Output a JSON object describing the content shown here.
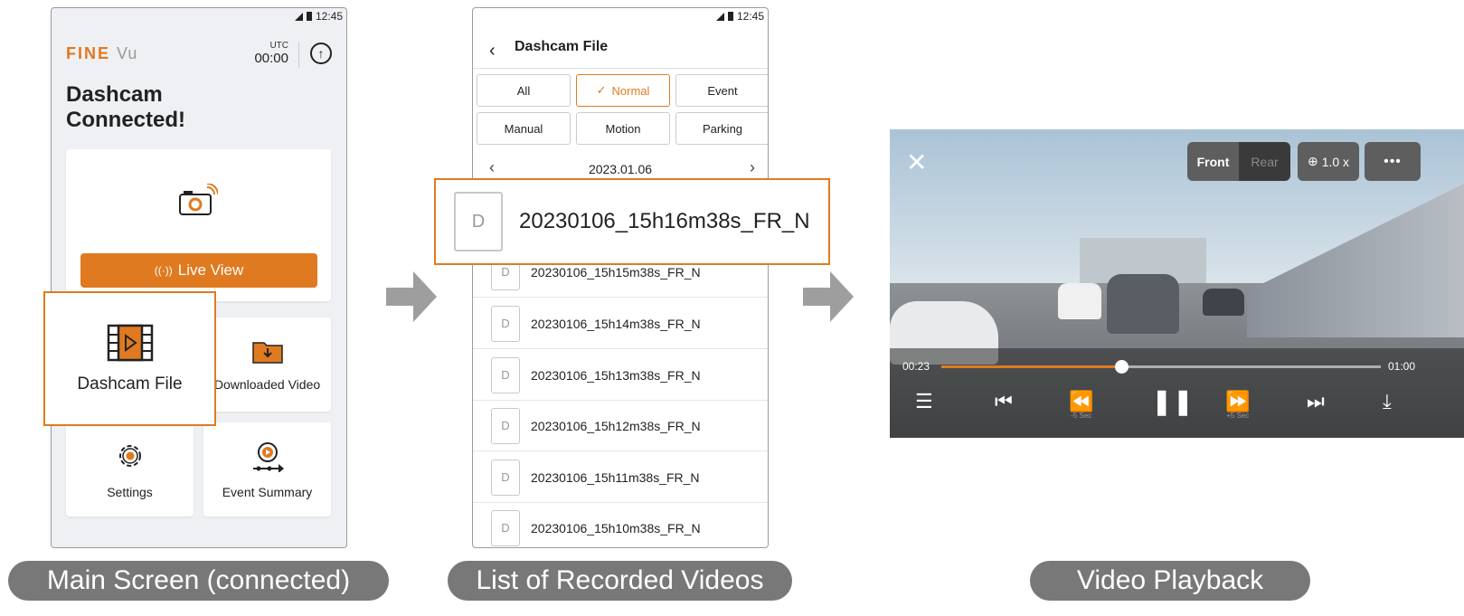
{
  "main_screen": {
    "status_time": "12:45",
    "logo_fine": "FINE",
    "logo_vu": "Vu",
    "utc_label": "UTC",
    "utc_time": "00:00",
    "headline": "Dashcam Connected!",
    "live_view_label": "Live View",
    "dashcam_file_label": "Dashcam File",
    "downloaded_video_label": "Downloaded Video",
    "settings_label": "Settings",
    "event_summary_label": "Event Summary",
    "accent_color": "#e07a20"
  },
  "file_list": {
    "status_time": "12:45",
    "title": "Dashcam File",
    "filters": [
      "All",
      "Normal",
      "Event",
      "Manual",
      "Motion",
      "Parking"
    ],
    "active_filter": "Normal",
    "date": "2023.01.06",
    "highlighted_file": "20230106_15h16m38s_FR_N",
    "file_icon_letter": "D",
    "files": [
      "20230106_15h15m38s_FR_N",
      "20230106_15h14m38s_FR_N",
      "20230106_15h13m38s_FR_N",
      "20230106_15h12m38s_FR_N",
      "20230106_15h11m38s_FR_N",
      "20230106_15h10m38s_FR_N"
    ]
  },
  "player": {
    "front_label": "Front",
    "rear_label": "Rear",
    "zoom_label": "1.0 x",
    "current_time": "00:23",
    "end_time": "01:00",
    "progress_fraction": 0.41,
    "rewind_label": "-5 Sec",
    "forward_label": "+5 Sec"
  },
  "captions": {
    "main": "Main Screen (connected)",
    "list": "List of Recorded Videos",
    "playback": "Video Playback"
  }
}
